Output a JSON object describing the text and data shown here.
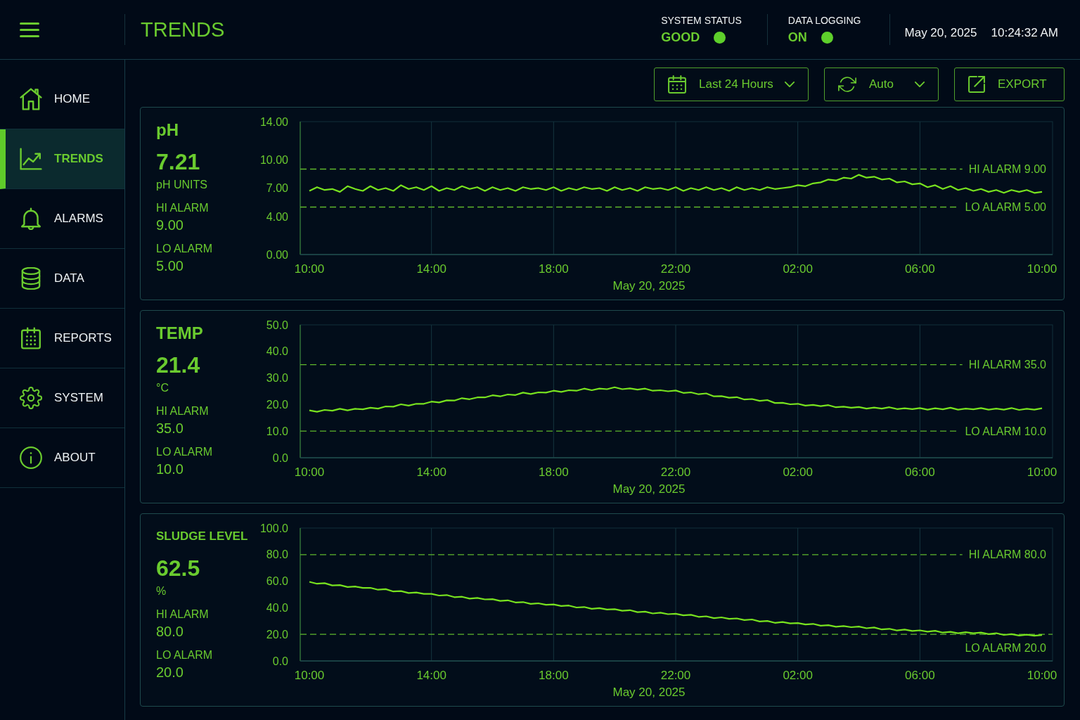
{
  "header": {
    "title": "TRENDS",
    "status": [
      {
        "label": "SYSTEM STATUS",
        "value": "GOOD",
        "color": "#5ecf2b"
      },
      {
        "label": "DATA LOGGING",
        "value": "ON",
        "color": "#5ecf2b"
      }
    ],
    "date": "May 20, 2025",
    "time": "10:24:32 AM"
  },
  "sidebar": {
    "items": [
      {
        "label": "HOME",
        "selected": false
      },
      {
        "label": "TRENDS",
        "selected": true
      },
      {
        "label": "ALARMS",
        "selected": false
      },
      {
        "label": "DATA",
        "selected": false
      },
      {
        "label": "REPORTS",
        "selected": false
      },
      {
        "label": "SYSTEM",
        "selected": false
      },
      {
        "label": "ABOUT",
        "selected": false
      }
    ]
  },
  "toolbar": [
    {
      "kind": "dropdown",
      "label": "Last 24 Hours"
    },
    {
      "kind": "dropdown",
      "label": "Auto"
    },
    {
      "kind": "button",
      "label": "EXPORT"
    }
  ],
  "panels": [
    {
      "title": "pH",
      "value": "7.21",
      "unit": "pH UNITS",
      "alarms": [
        {
          "label": "HI ALARM",
          "value": "9.00"
        },
        {
          "label": "LO ALARM",
          "value": "5.00"
        }
      ],
      "chart_data": {
        "type": "line",
        "xlabel": "May 20, 2025",
        "grid": true,
        "categories": [
          "10:00",
          null,
          null,
          null,
          null,
          null,
          null,
          null,
          null,
          null,
          null,
          null,
          null,
          null,
          null,
          null,
          "14:00",
          null,
          null,
          null,
          null,
          null,
          null,
          null,
          null,
          null,
          null,
          null,
          null,
          null,
          null,
          null,
          "18:00",
          null,
          null,
          null,
          null,
          null,
          null,
          null,
          null,
          null,
          null,
          null,
          null,
          null,
          null,
          null,
          "22:00",
          null,
          null,
          null,
          null,
          null,
          null,
          null,
          null,
          null,
          null,
          null,
          null,
          null,
          null,
          null,
          "02:00",
          null,
          null,
          null,
          null,
          null,
          null,
          null,
          null,
          null,
          null,
          null,
          null,
          null,
          null,
          null,
          "06:00",
          null,
          null,
          null,
          null,
          null,
          null,
          null,
          null,
          null,
          null,
          null,
          null,
          null,
          null,
          null,
          "10:00"
        ],
        "series": [
          {
            "color": "#78e21f",
            "values": [
              6.7,
              7.1,
              6.8,
              6.9,
              6.6,
              7.2,
              6.9,
              6.7,
              7.2,
              6.8,
              7.0,
              6.7,
              7.3,
              6.9,
              7.1,
              6.8,
              7.2,
              6.7,
              7.0,
              6.8,
              7.2,
              6.9,
              7.1,
              6.7,
              7.1,
              6.8,
              7.0,
              6.7,
              7.1,
              6.9,
              7.0,
              6.8,
              7.1,
              6.7,
              7.0,
              6.8,
              7.1,
              6.9,
              7.0,
              6.7,
              7.1,
              6.8,
              7.0,
              6.7,
              7.1,
              6.9,
              7.0,
              6.8,
              7.1,
              6.7,
              7.0,
              6.8,
              7.1,
              6.8,
              7.0,
              6.7,
              7.1,
              6.8,
              7.0,
              6.8,
              7.1,
              6.9,
              7.0,
              7.1,
              7.3,
              7.2,
              7.5,
              7.6,
              7.9,
              7.8,
              8.1,
              8.0,
              8.4,
              8.1,
              8.2,
              7.9,
              8.0,
              7.6,
              7.7,
              7.4,
              7.5,
              7.1,
              7.3,
              6.9,
              7.2,
              6.8,
              7.0,
              6.7,
              6.9,
              6.6,
              6.8,
              6.5,
              6.8,
              6.6,
              6.8,
              6.5,
              6.6
            ]
          }
        ],
        "ylim": [
          0,
          14
        ],
        "yticks": [
          {
            "value": 0,
            "label": "0.00"
          },
          {
            "value": 4,
            "label": "4.00"
          },
          {
            "value": 7,
            "label": "7.00"
          },
          {
            "value": 10,
            "label": "10.00"
          },
          {
            "value": 14,
            "label": "14.00"
          }
        ],
        "ref_lines": [
          {
            "axis": "y",
            "value": 9,
            "label": "HI ALARM 9.00"
          },
          {
            "axis": "y",
            "value": 5,
            "label": "LO ALARM 5.00"
          }
        ]
      }
    },
    {
      "title": "TEMP",
      "value": "21.4",
      "unit": "°C",
      "alarms": [
        {
          "label": "HI ALARM",
          "value": "35.0"
        },
        {
          "label": "LO ALARM",
          "value": "10.0"
        }
      ],
      "chart_data": {
        "type": "line",
        "xlabel": "May 20, 2025",
        "grid": true,
        "categories": [
          "10:00",
          null,
          null,
          null,
          null,
          null,
          null,
          null,
          null,
          null,
          null,
          null,
          null,
          null,
          null,
          null,
          "14:00",
          null,
          null,
          null,
          null,
          null,
          null,
          null,
          null,
          null,
          null,
          null,
          null,
          null,
          null,
          null,
          "18:00",
          null,
          null,
          null,
          null,
          null,
          null,
          null,
          null,
          null,
          null,
          null,
          null,
          null,
          null,
          null,
          "22:00",
          null,
          null,
          null,
          null,
          null,
          null,
          null,
          null,
          null,
          null,
          null,
          null,
          null,
          null,
          null,
          "02:00",
          null,
          null,
          null,
          null,
          null,
          null,
          null,
          null,
          null,
          null,
          null,
          null,
          null,
          null,
          null,
          "06:00",
          null,
          null,
          null,
          null,
          null,
          null,
          null,
          null,
          null,
          null,
          null,
          null,
          null,
          null,
          null,
          "10:00"
        ],
        "series": [
          {
            "color": "#78e21f",
            "values": [
              17.8,
              17.3,
              18.0,
              17.7,
              18.4,
              17.8,
              18.4,
              18.2,
              18.8,
              18.5,
              19.3,
              19.2,
              20.1,
              19.6,
              20.3,
              20.3,
              21.1,
              20.8,
              21.6,
              21.5,
              22.4,
              22.0,
              22.7,
              22.7,
              23.5,
              23.1,
              23.8,
              23.6,
              24.5,
              24.0,
              24.6,
              24.5,
              25.2,
              24.8,
              25.4,
              25.2,
              26.0,
              25.4,
              26.0,
              25.8,
              26.5,
              25.8,
              26.1,
              25.6,
              26.0,
              25.2,
              25.4,
              25.0,
              25.3,
              24.4,
              24.6,
              23.9,
              24.2,
              23.1,
              23.2,
              22.6,
              22.8,
              21.9,
              22.1,
              21.4,
              21.7,
              20.6,
              20.7,
              20.1,
              20.3,
              19.6,
              19.9,
              19.4,
              19.8,
              19.0,
              19.2,
              18.8,
              19.1,
              18.5,
              18.9,
              18.5,
              19.0,
              18.3,
              18.6,
              18.3,
              18.7,
              18.1,
              18.6,
              18.2,
              18.8,
              18.1,
              18.5,
              18.2,
              18.7,
              18.1,
              18.5,
              18.1,
              18.7,
              18.0,
              18.4,
              18.1,
              18.6
            ]
          }
        ],
        "ylim": [
          0,
          50
        ],
        "yticks": [
          {
            "value": 0,
            "label": "0.0"
          },
          {
            "value": 10,
            "label": "10.0"
          },
          {
            "value": 20,
            "label": "20.0"
          },
          {
            "value": 30,
            "label": "30.0"
          },
          {
            "value": 40,
            "label": "40.0"
          },
          {
            "value": 50,
            "label": "50.0"
          }
        ],
        "ref_lines": [
          {
            "axis": "y",
            "value": 35,
            "label": "HI ALARM 35.0"
          },
          {
            "axis": "y",
            "value": 10,
            "label": "LO ALARM 10.0"
          }
        ]
      }
    },
    {
      "title": "SLUDGE LEVEL",
      "value": "62.5",
      "unit": "%",
      "alarms": [
        {
          "label": "HI ALARM",
          "value": "80.0"
        },
        {
          "label": "LO ALARM",
          "value": "20.0"
        }
      ],
      "chart_data": {
        "type": "line",
        "xlabel": "May 20, 2025",
        "grid": true,
        "categories": [
          "10:00",
          null,
          null,
          null,
          null,
          null,
          null,
          null,
          null,
          null,
          null,
          null,
          null,
          null,
          null,
          null,
          "14:00",
          null,
          null,
          null,
          null,
          null,
          null,
          null,
          null,
          null,
          null,
          null,
          null,
          null,
          null,
          null,
          "18:00",
          null,
          null,
          null,
          null,
          null,
          null,
          null,
          null,
          null,
          null,
          null,
          null,
          null,
          null,
          null,
          "22:00",
          null,
          null,
          null,
          null,
          null,
          null,
          null,
          null,
          null,
          null,
          null,
          null,
          null,
          null,
          null,
          "02:00",
          null,
          null,
          null,
          null,
          null,
          null,
          null,
          null,
          null,
          null,
          null,
          null,
          null,
          null,
          null,
          "06:00",
          null,
          null,
          null,
          null,
          null,
          null,
          null,
          null,
          null,
          null,
          null,
          null,
          null,
          null,
          null,
          "10:00"
        ],
        "series": [
          {
            "color": "#78e21f",
            "values": [
              59.5,
              58.1,
              58.5,
              56.8,
              57.1,
              55.6,
              56.0,
              54.9,
              55.0,
              53.6,
              54.0,
              52.3,
              52.6,
              51.1,
              51.5,
              50.4,
              50.5,
              49.2,
              49.6,
              48.0,
              48.3,
              46.9,
              47.4,
              46.3,
              46.5,
              45.2,
              45.6,
              44.0,
              44.3,
              42.9,
              43.4,
              42.3,
              42.5,
              41.3,
              41.7,
              40.2,
              40.6,
              39.2,
              39.8,
              38.7,
              39.0,
              37.8,
              38.2,
              36.7,
              37.1,
              35.7,
              36.3,
              35.2,
              35.5,
              34.3,
              34.7,
              33.2,
              33.6,
              32.2,
              32.8,
              31.7,
              32.0,
              30.8,
              31.2,
              29.7,
              30.1,
              28.7,
              29.3,
              28.2,
              28.5,
              27.4,
              27.9,
              26.5,
              26.9,
              25.7,
              26.3,
              25.4,
              25.8,
              24.6,
              25.2,
              23.7,
              24.2,
              22.9,
              23.6,
              22.6,
              23.0,
              22.0,
              22.7,
              21.3,
              21.9,
              20.8,
              21.6,
              20.8,
              21.3,
              20.2,
              20.9,
              19.6,
              20.2,
              19.1,
              19.8,
              19.0,
              19.5
            ]
          }
        ],
        "ylim": [
          0,
          100
        ],
        "yticks": [
          {
            "value": 0,
            "label": "0.0"
          },
          {
            "value": 20,
            "label": "20.0"
          },
          {
            "value": 40,
            "label": "40.0"
          },
          {
            "value": 60,
            "label": "60.0"
          },
          {
            "value": 80,
            "label": "80.0"
          },
          {
            "value": 100,
            "label": "100.0"
          }
        ],
        "ref_lines": [
          {
            "axis": "y",
            "value": 80,
            "label": "HI ALARM 80.0"
          },
          {
            "axis": "y",
            "value": 20,
            "label": "LO ALARM 20.0"
          }
        ]
      }
    }
  ]
}
